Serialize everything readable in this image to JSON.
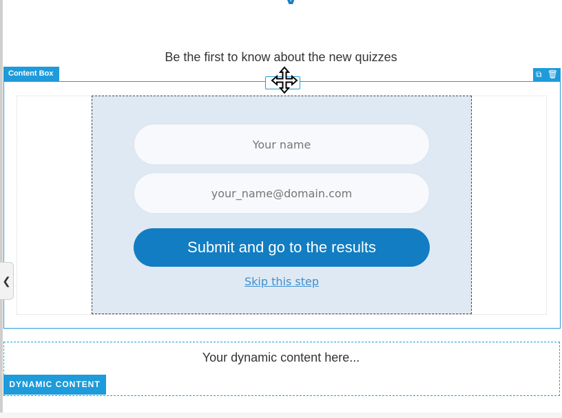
{
  "page": {
    "headline_fragment": "y",
    "subtitle": "Be the first to know about the new quizzes"
  },
  "content_box": {
    "label": "Content Box",
    "actions": [
      "duplicate-icon",
      "trash-icon"
    ],
    "accent_color": "#1e9bdb"
  },
  "form": {
    "name_placeholder": "Your name",
    "email_placeholder": "your_name@domain.com",
    "submit_label": "Submit and go to the results",
    "skip_label": "Skip this step",
    "panel_color": "#dfe9f3",
    "button_color": "#127dc2"
  },
  "sidebar_toggle": {
    "icon": "chevron-left-icon",
    "glyph": "❮"
  },
  "dynamic_content": {
    "text": "Your dynamic content here...",
    "label": "DYNAMIC CONTENT"
  }
}
